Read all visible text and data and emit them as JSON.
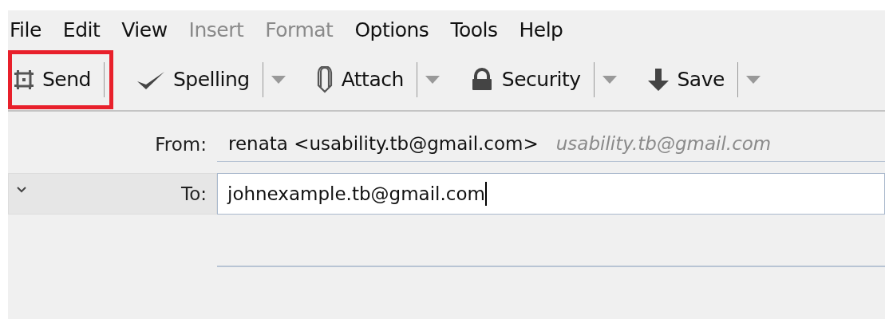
{
  "menu": [
    {
      "label": "File",
      "disabled": false
    },
    {
      "label": "Edit",
      "disabled": false
    },
    {
      "label": "View",
      "disabled": false
    },
    {
      "label": "Insert",
      "disabled": true
    },
    {
      "label": "Format",
      "disabled": true
    },
    {
      "label": "Options",
      "disabled": false
    },
    {
      "label": "Tools",
      "disabled": false
    },
    {
      "label": "Help",
      "disabled": false
    }
  ],
  "toolbar": [
    {
      "label": "Send",
      "kind": "button",
      "highlighted": true
    },
    {
      "label": "Spelling",
      "kind": "menubutton",
      "highlighted": false
    },
    {
      "label": "Attach",
      "kind": "menubutton",
      "highlighted": false
    },
    {
      "label": "Security",
      "kind": "menubutton",
      "highlighted": false
    },
    {
      "label": "Save",
      "kind": "menubutton",
      "highlighted": false
    }
  ],
  "from": {
    "label": "From:",
    "value": "renata <usability.tb@gmail.com>",
    "identity": "usability.tb@gmail.com"
  },
  "recipients": [
    {
      "label": "To:",
      "value": "johnexample.tb@gmail.com",
      "expanded": false
    }
  ]
}
